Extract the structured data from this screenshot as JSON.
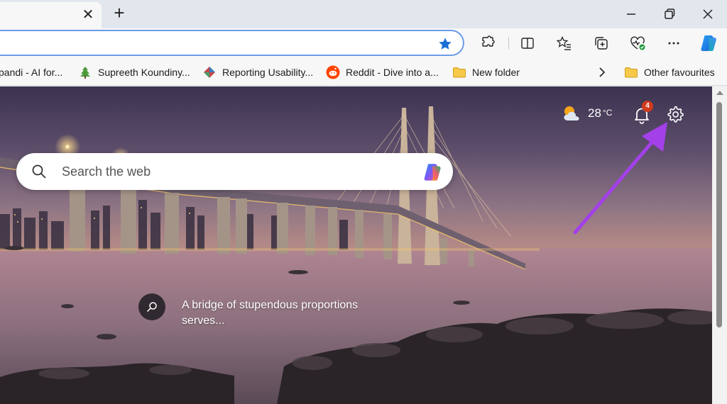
{
  "browser": {
    "tab_close_glyph": "✕",
    "new_tab_glyph": "+"
  },
  "favourites": {
    "items": [
      {
        "label": "pandi - AI for...",
        "icon": "ai-site-icon"
      },
      {
        "label": "Supreeth Koundiny...",
        "icon": "tree-icon"
      },
      {
        "label": "Reporting Usability...",
        "icon": "diamond-icon"
      },
      {
        "label": "Reddit - Dive into a...",
        "icon": "reddit-icon"
      },
      {
        "label": "New folder",
        "icon": "folder-icon"
      }
    ],
    "other_label": "Other favourites"
  },
  "newtab": {
    "search_placeholder": "Search the web",
    "weather_temp": "28",
    "weather_unit": "°C",
    "notification_count": "4",
    "caption": "A bridge of stupendous proportions serves..."
  },
  "colors": {
    "accent_blue": "#1a6fd6",
    "badge_red": "#d13b1e",
    "annotation_arrow": "#a340e8"
  }
}
